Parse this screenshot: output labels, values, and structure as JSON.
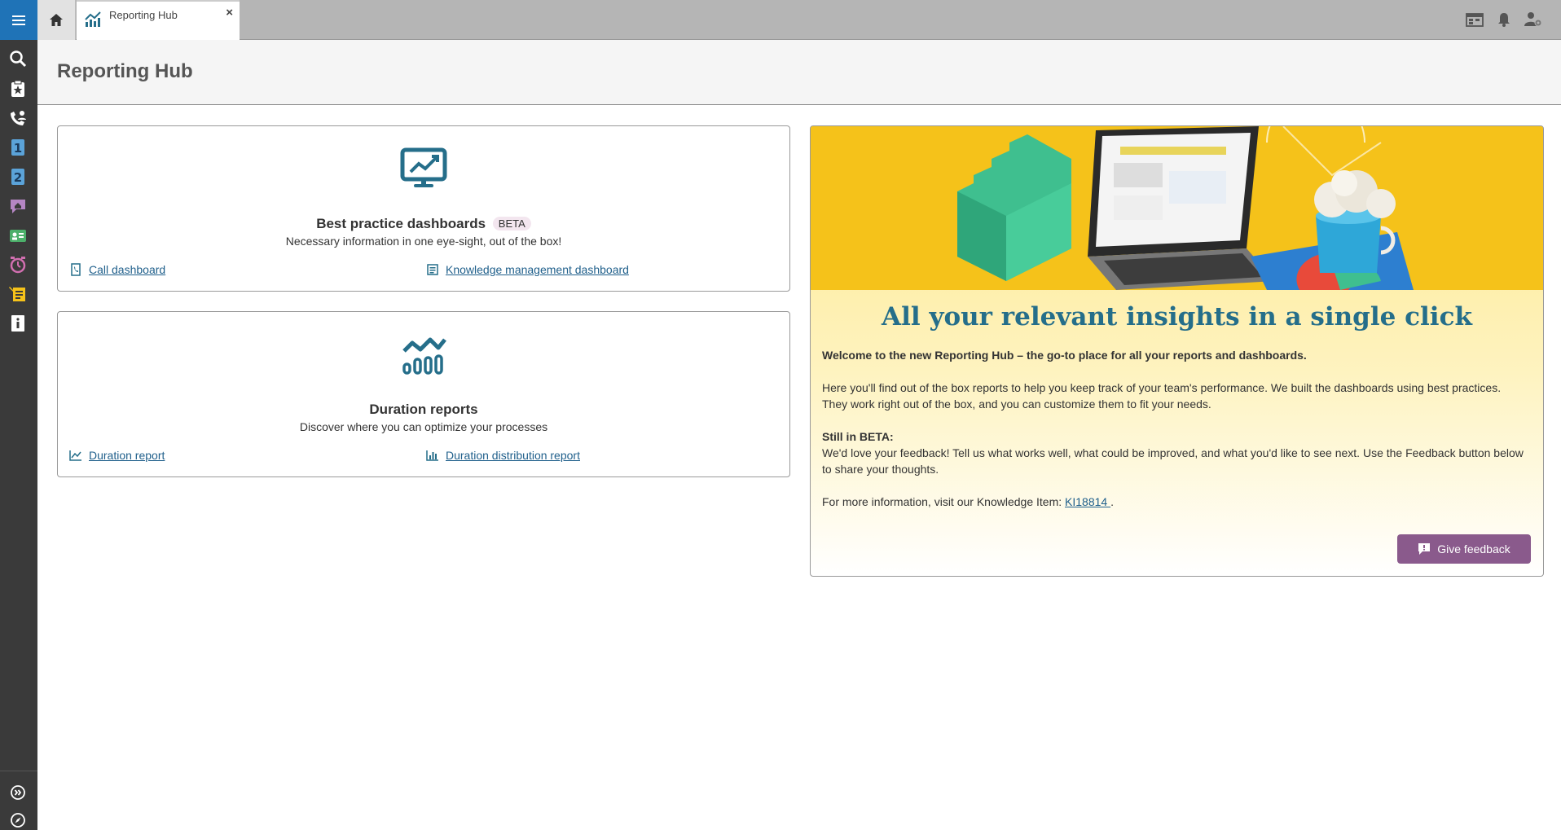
{
  "topbar": {
    "tab_label": "Reporting Hub",
    "tab_close": "×"
  },
  "page": {
    "title": "Reporting Hub"
  },
  "cards": [
    {
      "title": "Best practice dashboards",
      "badge": "BETA",
      "subtitle": "Necessary information in one eye-sight, out of the box!",
      "links": [
        "Call dashboard",
        "Knowledge management dashboard"
      ]
    },
    {
      "title": "Duration reports",
      "subtitle": "Discover where you can optimize your processes",
      "links": [
        "Duration report",
        "Duration distribution report"
      ]
    }
  ],
  "banner": {
    "heading": "All your relevant insights in a single click",
    "welcome": "Welcome to the new Reporting Hub – the go-to place for all your reports and dashboards.",
    "intro": "Here you'll find out of the box reports to help you keep track of your team's performance. We built the dashboards using best practices. They work right out of the box, and you can customize them to fit your needs.",
    "beta_heading": "Still in BETA:",
    "beta_text": "We'd love your feedback! Tell us what works well, what could be improved, and what you'd like to see next. Use the Feedback button below to share your thoughts.",
    "more_info": "For more information, visit our Knowledge Item: ",
    "ki_link": "KI18814 ",
    "more_info_end": ".",
    "feedback_label": "Give feedback"
  },
  "colors": {
    "menu_blue": "#1f73b7",
    "accent_teal": "#256e8a",
    "link_blue": "#1f5f8b",
    "feedback_purple": "#8a5a8c",
    "banner_yellow": "#f5c21a"
  }
}
